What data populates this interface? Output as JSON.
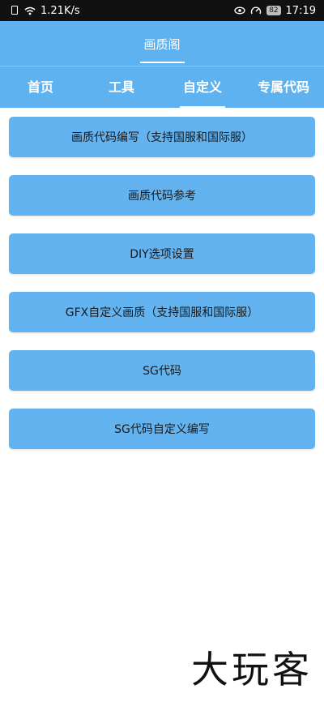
{
  "status_bar": {
    "network_speed": "1.21K/s",
    "battery": "82",
    "time": "17:19"
  },
  "header": {
    "title": "画质阁"
  },
  "tabs": [
    {
      "label": "首页",
      "active": false
    },
    {
      "label": "工具",
      "active": false
    },
    {
      "label": "自定义",
      "active": true
    },
    {
      "label": "专属代码",
      "active": false
    }
  ],
  "menu": [
    {
      "label": "画质代码编写（支持国服和国际服）"
    },
    {
      "label": "画质代码参考"
    },
    {
      "label": "DIY选项设置"
    },
    {
      "label": "GFX自定义画质（支持国服和国际服）"
    },
    {
      "label": "SG代码"
    },
    {
      "label": "SG代码自定义编写"
    }
  ],
  "watermark": "大玩客",
  "colors": {
    "primary": "#5eb2ef",
    "button": "#62b3ef",
    "status_bar": "#111111"
  }
}
